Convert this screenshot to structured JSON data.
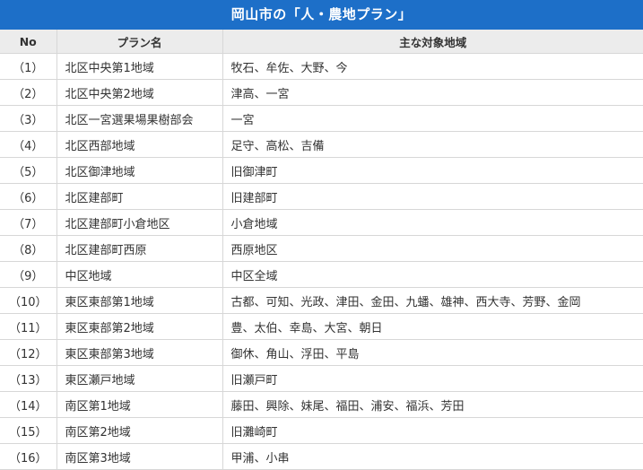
{
  "title": "岡山市の「人・農地プラン」",
  "header": {
    "no": "No",
    "plan_name": "プラン名",
    "target_area": "主な対象地域"
  },
  "rows": [
    {
      "no": "（1）",
      "plan": "北区中央第1地域",
      "area": "牧石、牟佐、大野、今"
    },
    {
      "no": "（2）",
      "plan": "北区中央第2地域",
      "area": "津高、一宮"
    },
    {
      "no": "（3）",
      "plan": "北区一宮選果場果樹部会",
      "area": "一宮"
    },
    {
      "no": "（4）",
      "plan": "北区西部地域",
      "area": "足守、高松、吉備"
    },
    {
      "no": "（5）",
      "plan": "北区御津地域",
      "area": "旧御津町"
    },
    {
      "no": "（6）",
      "plan": "北区建部町",
      "area": "旧建部町"
    },
    {
      "no": "（7）",
      "plan": "北区建部町小倉地区",
      "area": "小倉地域"
    },
    {
      "no": "（8）",
      "plan": "北区建部町西原",
      "area": "西原地区"
    },
    {
      "no": "（9）",
      "plan": "中区地域",
      "area": "中区全域"
    },
    {
      "no": "（10）",
      "plan": "東区東部第1地域",
      "area": "古都、可知、光政、津田、金田、九蟠、雄神、西大寺、芳野、金岡"
    },
    {
      "no": "（11）",
      "plan": "東区東部第2地域",
      "area": "豊、太伯、幸島、大宮、朝日"
    },
    {
      "no": "（12）",
      "plan": "東区東部第3地域",
      "area": "御休、角山、浮田、平島"
    },
    {
      "no": "（13）",
      "plan": "東区瀬戸地域",
      "area": "旧瀬戸町"
    },
    {
      "no": "（14）",
      "plan": "南区第1地域",
      "area": "藤田、興除、妹尾、福田、浦安、福浜、芳田"
    },
    {
      "no": "（15）",
      "plan": "南区第2地域",
      "area": "旧灘崎町"
    },
    {
      "no": "（16）",
      "plan": "南区第3地域",
      "area": "甲浦、小串"
    }
  ]
}
